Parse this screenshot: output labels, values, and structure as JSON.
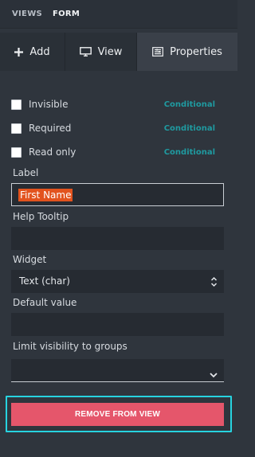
{
  "breadcrumb": {
    "views": "VIEWS",
    "form": "FORM"
  },
  "tabs": [
    {
      "label": "Add",
      "icon": "plus-icon"
    },
    {
      "label": "View",
      "icon": "monitor-icon"
    },
    {
      "label": "Properties",
      "icon": "properties-icon",
      "active": true
    }
  ],
  "checkboxes": [
    {
      "label": "Invisible",
      "conditional": "Conditional",
      "checked": false
    },
    {
      "label": "Required",
      "conditional": "Conditional",
      "checked": false
    },
    {
      "label": "Read only",
      "conditional": "Conditional",
      "checked": false
    }
  ],
  "fields": {
    "label": {
      "title": "Label",
      "value": "First Name"
    },
    "help_tooltip": {
      "title": "Help Tooltip",
      "value": ""
    },
    "widget": {
      "title": "Widget",
      "value": "Text (char)"
    },
    "default_value": {
      "title": "Default value",
      "value": ""
    },
    "groups": {
      "title": "Limit visibility to groups",
      "value": ""
    }
  },
  "actions": {
    "remove": "REMOVE FROM VIEW"
  },
  "colors": {
    "accent_teal": "#1f9aa0",
    "focus_ring": "#27d3e0",
    "danger": "#e5566b",
    "selection": "#e2531e"
  }
}
